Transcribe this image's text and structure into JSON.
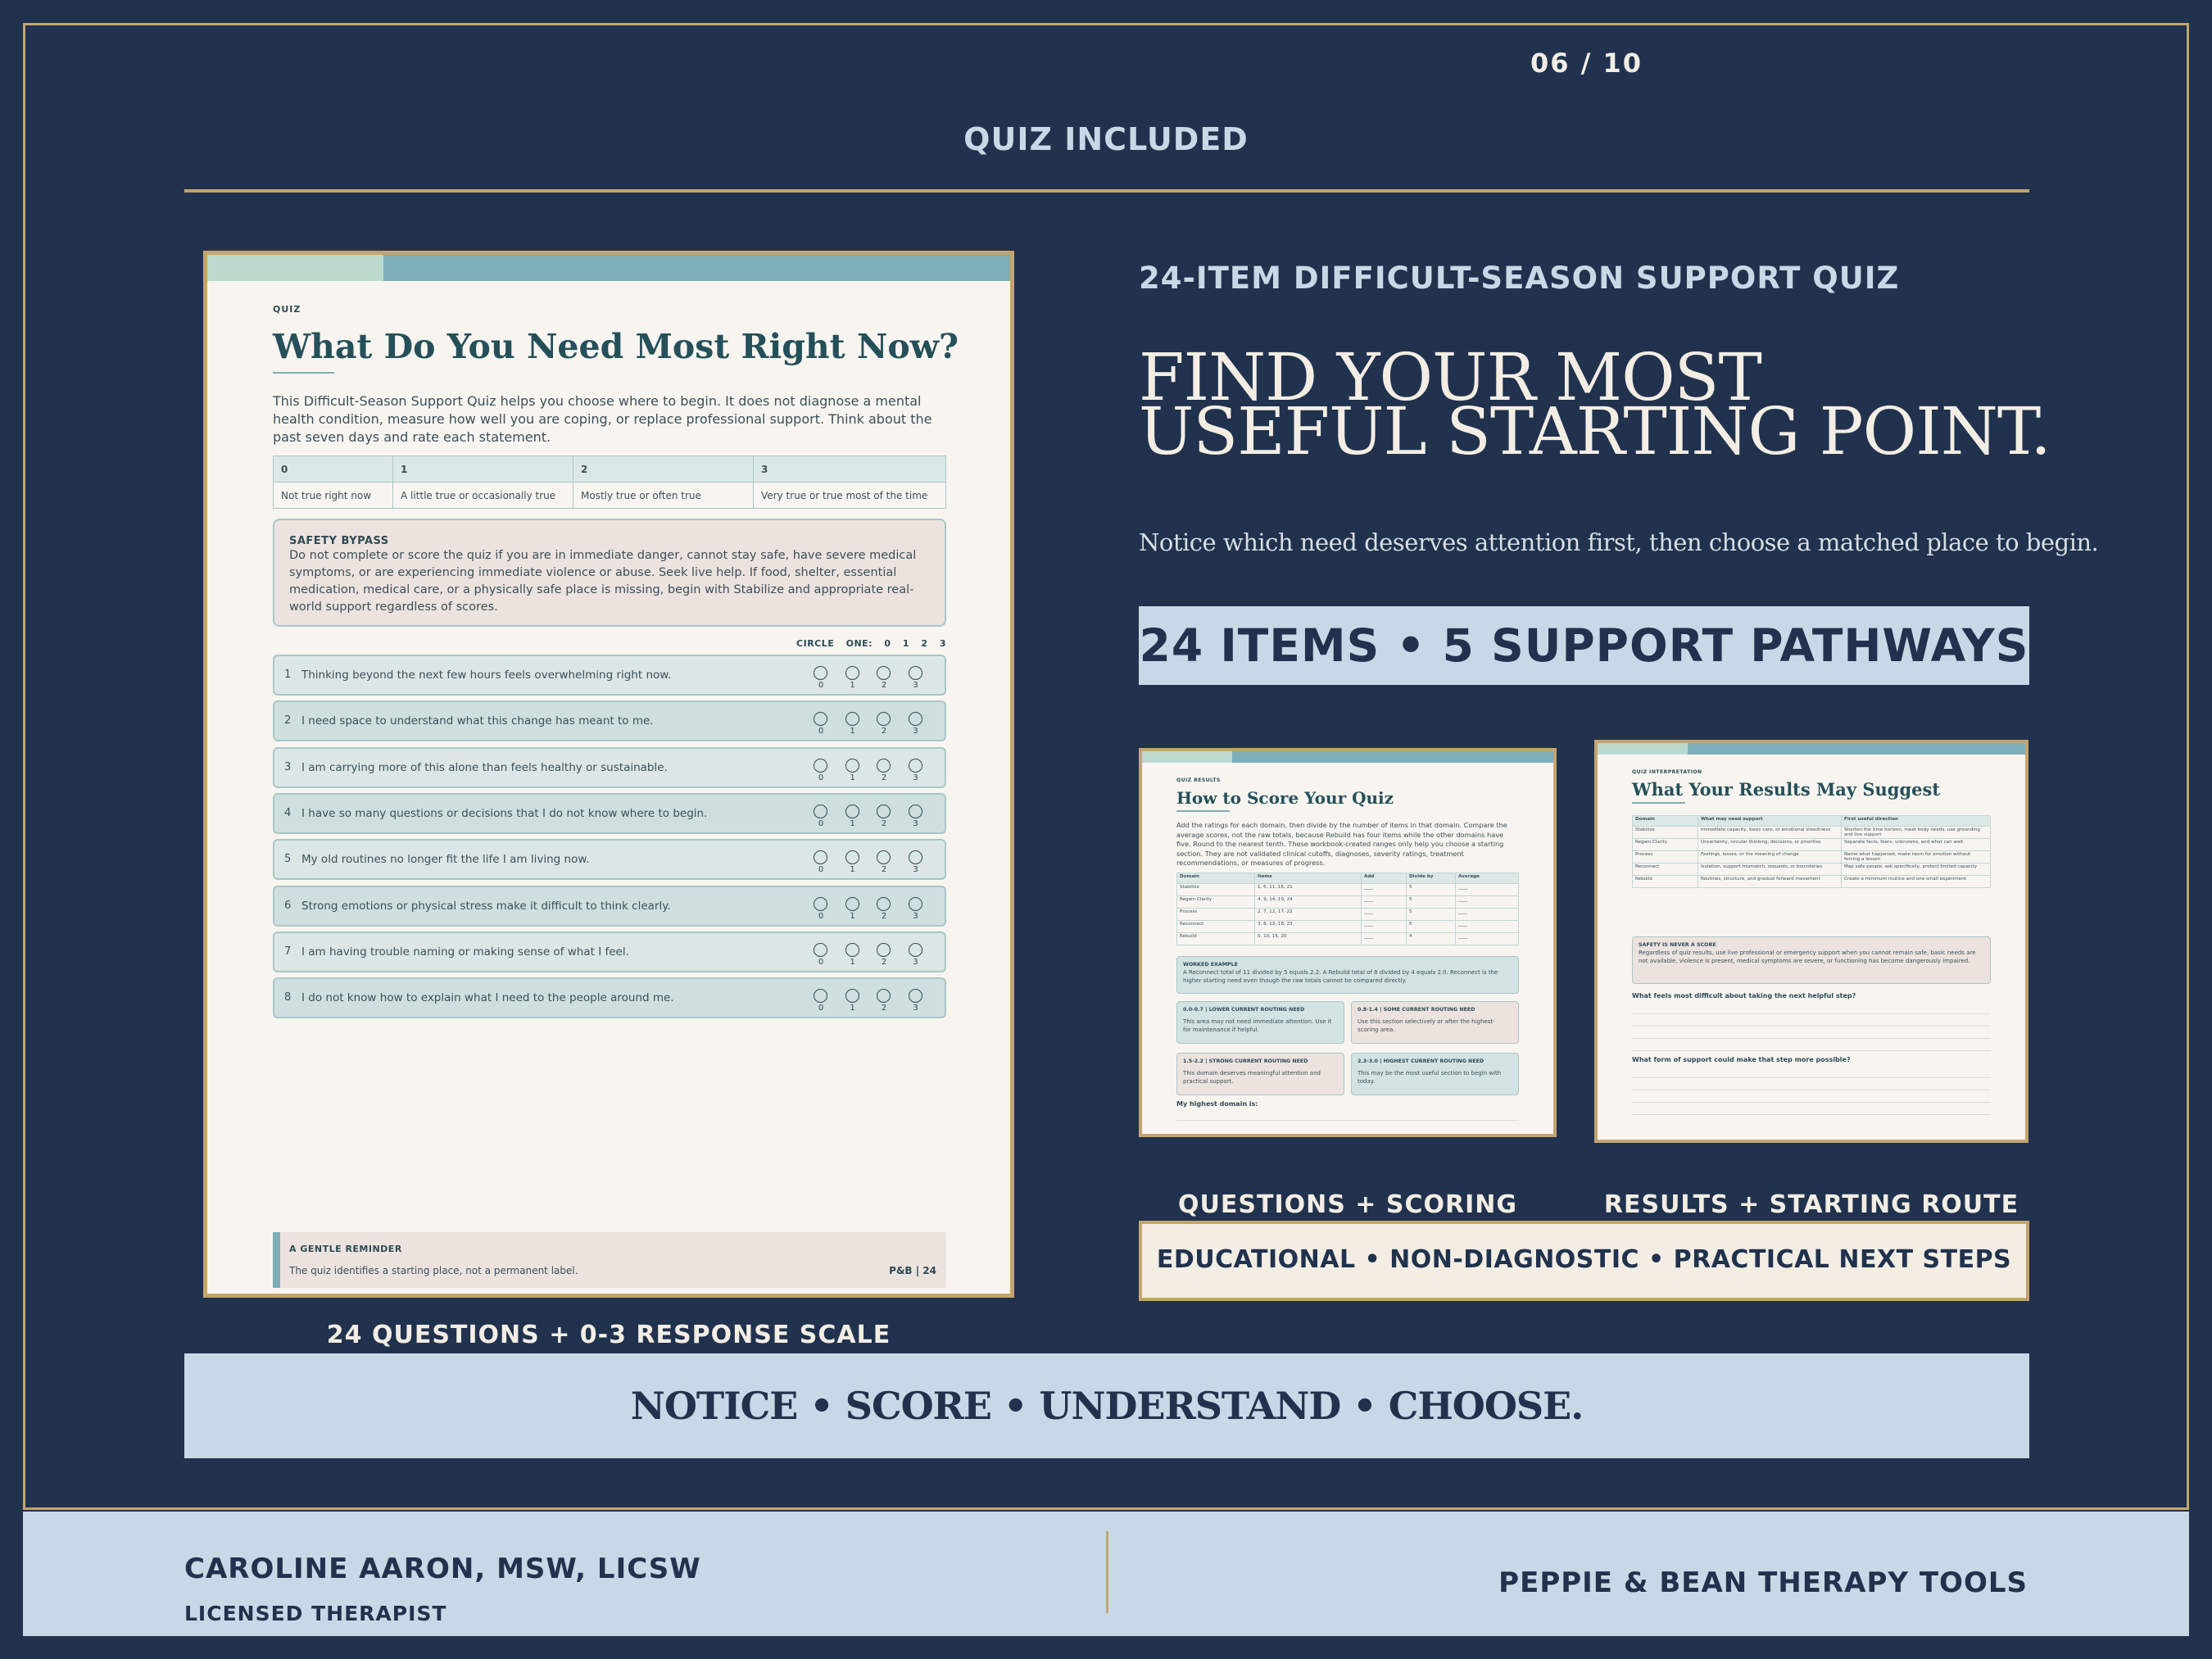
{
  "page_counter": "06 / 10",
  "section_label": "QUIZ INCLUDED",
  "quiz_page": {
    "label": "QUIZ",
    "title": "What Do You Need Most Right Now?",
    "intro": "This Difficult-Season Support Quiz helps you choose where to begin. It does not diagnose a mental health condition, measure how well you are coping, or replace professional support. Think about the past seven days and rate each statement.",
    "scale": [
      {
        "value": "0",
        "meaning": "Not true right now"
      },
      {
        "value": "1",
        "meaning": "A little true or occasionally true"
      },
      {
        "value": "2",
        "meaning": "Mostly true or often true"
      },
      {
        "value": "3",
        "meaning": "Very true or true most of the time"
      }
    ],
    "safety_title": "SAFETY BYPASS",
    "safety_text": "Do not complete or score the quiz if you are in immediate danger, cannot stay safe, have severe medical symptoms, or are experiencing immediate violence or abuse. Seek live help. If food, shelter, essential medication, medical care, or a physically safe place is missing, begin with Stabilize and appropriate real-world support regardless of scores.",
    "circle_one": "CIRCLE ONE: 0 1 2 3",
    "items": [
      {
        "num": "1",
        "text": "Thinking beyond the next few hours feels overwhelming right now."
      },
      {
        "num": "2",
        "text": "I need space to understand what this change has meant to me."
      },
      {
        "num": "3",
        "text": "I am carrying more of this alone than feels healthy or sustainable."
      },
      {
        "num": "4",
        "text": "I have so many questions or decisions that I do not know where to begin."
      },
      {
        "num": "5",
        "text": "My old routines no longer fit the life I am living now."
      },
      {
        "num": "6",
        "text": "Strong emotions or physical stress make it difficult to think clearly."
      },
      {
        "num": "7",
        "text": "I am having trouble naming or making sense of what I feel."
      },
      {
        "num": "8",
        "text": "I do not know how to explain what I need to the people around me."
      }
    ],
    "options": [
      "0",
      "1",
      "2",
      "3"
    ],
    "reminder_title": "A GENTLE REMINDER",
    "reminder_text": "The quiz identifies a starting place, not a permanent label.",
    "page_number": "P&B | 24"
  },
  "main_caption": "24 QUESTIONS + 0-3 RESPONSE SCALE",
  "sub_kicker": "24-ITEM DIFFICULT-SEASON SUPPORT QUIZ",
  "headline": "FIND YOUR MOST USEFUL STARTING POINT.",
  "tagline": "Notice which need deserves attention first, then choose a matched place to begin.",
  "count_band": "24 ITEMS  •  5 SUPPORT PATHWAYS",
  "score_page": {
    "label": "QUIZ RESULTS",
    "title": "How to Score Your Quiz",
    "intro": "Add the ratings for each domain, then divide by the number of items in that domain. Compare the average scores, not the raw totals, because Rebuild has four items while the other domains have five. Round to the nearest tenth. These workbook-created ranges only help you choose a starting section. They are not validated clinical cutoffs, diagnoses, severity ratings, treatment recommendations, or measures of progress.",
    "headers": [
      "Domain",
      "Items",
      "Add",
      "Divide by",
      "Average"
    ],
    "rows": [
      [
        "Stabilize",
        "1, 6, 11, 16, 21",
        "____",
        "5",
        "____"
      ],
      [
        "Regain Clarity",
        "4, 9, 14, 19, 24",
        "____",
        "5",
        "____"
      ],
      [
        "Process",
        "2, 7, 12, 17, 22",
        "____",
        "5",
        "____"
      ],
      [
        "Reconnect",
        "3, 8, 13, 18, 23",
        "____",
        "5",
        "____"
      ],
      [
        "Rebuild",
        "5, 10, 15, 20",
        "____",
        "4",
        "____"
      ]
    ],
    "worked_title": "WORKED EXAMPLE",
    "worked_text": "A Reconnect total of 11 divided by 5 equals 2.2. A Rebuild total of 8 divided by 4 equals 2.0. Reconnect is the higher starting need even though the raw totals cannot be compared directly.",
    "ranges": [
      {
        "title": "0.0-0.7 | LOWER CURRENT ROUTING NEED",
        "text": "This area may not need immediate attention. Use it for maintenance if helpful."
      },
      {
        "title": "0.8-1.4 | SOME CURRENT ROUTING NEED",
        "text": "Use this section selectively or after the highest-scoring area."
      },
      {
        "title": "1.5-2.2 | STRONG CURRENT ROUTING NEED",
        "text": "This domain deserves meaningful attention and practical support."
      },
      {
        "title": "2.3-3.0 | HIGHEST CURRENT ROUTING NEED",
        "text": "This may be the most useful section to begin with today."
      }
    ],
    "highest_label": "My highest domain is:"
  },
  "results_page": {
    "label": "QUIZ INTERPRETATION",
    "title": "What Your Results May Suggest",
    "headers": [
      "Domain",
      "What may need support",
      "First useful direction"
    ],
    "rows": [
      [
        "Stabilize",
        "Immediate capacity, basic care, or emotional steadiness",
        "Shorten the time horizon, meet body needs, use grounding and live support"
      ],
      [
        "Regain Clarity",
        "Uncertainty, circular thinking, decisions, or priorities",
        "Separate facts, fears, unknowns, and what can wait"
      ],
      [
        "Process",
        "Feelings, losses, or the meaning of change",
        "Name what happened, make room for emotion without forcing a lesson"
      ],
      [
        "Reconnect",
        "Isolation, support mismatch, requests, or boundaries",
        "Map safe people, ask specifically, protect limited capacity"
      ],
      [
        "Rebuild",
        "Routines, structure, and gradual forward movement",
        "Create a minimum routine and one small experiment"
      ]
    ],
    "safety_title": "SAFETY IS NEVER A SCORE",
    "safety_text": "Regardless of quiz results, use live professional or emergency support when you cannot remain safe, basic needs are not available, violence is present, medical symptoms are severe, or functioning has become dangerously impaired.",
    "question_1": "What feels most difficult about taking the next helpful step?",
    "question_2": "What form of support could make that step more possible?"
  },
  "thumb_caption_left": "QUESTIONS + SCORING",
  "thumb_caption_right": "RESULTS + STARTING ROUTE",
  "edu_band": "EDUCATIONAL  •  NON-DIAGNOSTIC  •  PRACTICAL NEXT STEPS",
  "motto": "NOTICE  •  SCORE  •  UNDERSTAND  •  CHOOSE.",
  "footer": {
    "name": "CAROLINE AARON, MSW, LICSW",
    "role": "LICENSED THERAPIST",
    "brand": "PEPPIE & BEAN THERAPY TOOLS"
  },
  "colors": {
    "navy": "#20324d",
    "gold": "#c4a46f",
    "light_blue": "#c6d9e6",
    "cream": "#f8f5f0",
    "teal": "#7eaeb8",
    "mint": "#bcd9ce",
    "blush": "#ece2de"
  }
}
